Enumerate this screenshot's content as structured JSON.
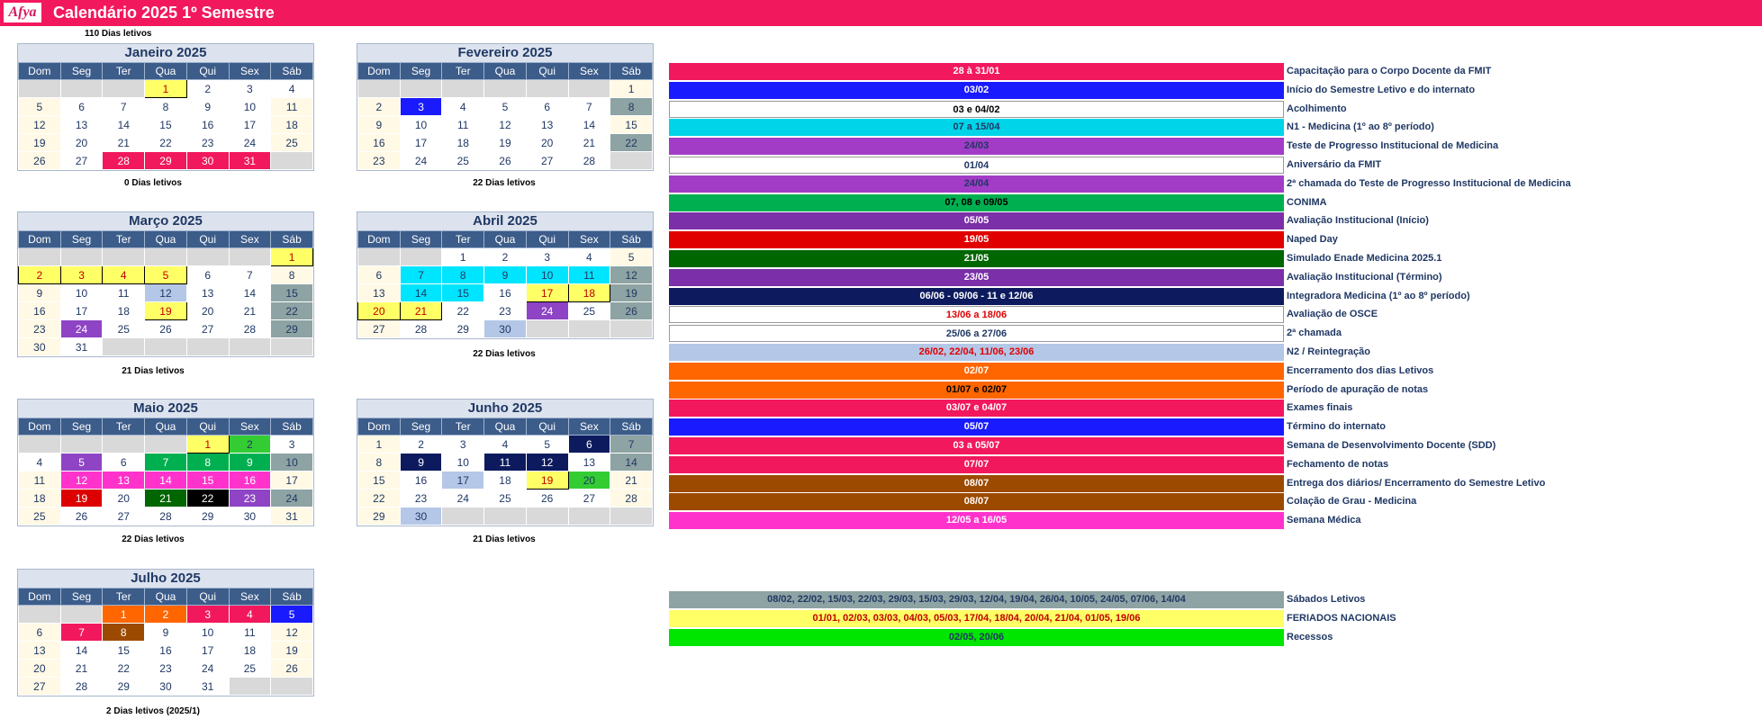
{
  "header": {
    "logo": "Afya",
    "title": "Calendário 2025  1º Semestre",
    "dias_letivos_total": "110  Dias letivos"
  },
  "weekdays": [
    "Dom",
    "Seg",
    "Ter",
    "Qua",
    "Qui",
    "Sex",
    "Sáb"
  ],
  "months": [
    {
      "name": "Janeiro 2025",
      "footer": "0  Dias letivos",
      "cells": [
        [
          "",
          ""
        ],
        [
          "",
          ""
        ],
        [
          "",
          ""
        ],
        [
          "1",
          "#ffff66"
        ],
        [
          "2",
          ""
        ],
        [
          "3",
          ""
        ],
        [
          "4",
          ""
        ],
        [
          "5",
          "w"
        ],
        [
          "6",
          ""
        ],
        [
          "7",
          ""
        ],
        [
          "8",
          ""
        ],
        [
          "9",
          ""
        ],
        [
          "10",
          ""
        ],
        [
          "11",
          "w"
        ],
        [
          "12",
          "w"
        ],
        [
          "13",
          ""
        ],
        [
          "14",
          ""
        ],
        [
          "15",
          ""
        ],
        [
          "16",
          ""
        ],
        [
          "17",
          ""
        ],
        [
          "18",
          "w"
        ],
        [
          "19",
          "w"
        ],
        [
          "20",
          ""
        ],
        [
          "21",
          ""
        ],
        [
          "22",
          ""
        ],
        [
          "23",
          ""
        ],
        [
          "24",
          ""
        ],
        [
          "25",
          "w"
        ],
        [
          "26",
          "w"
        ],
        [
          "27",
          ""
        ],
        [
          "28",
          "#f2185e"
        ],
        [
          "29",
          "#f2185e"
        ],
        [
          "30",
          "#f2185e"
        ],
        [
          "31",
          "#f2185e"
        ],
        [
          "",
          ""
        ]
      ]
    },
    {
      "name": "Fevereiro 2025",
      "footer": "22  Dias letivos",
      "cells": [
        [
          "",
          ""
        ],
        [
          "",
          ""
        ],
        [
          "",
          ""
        ],
        [
          "",
          ""
        ],
        [
          "",
          ""
        ],
        [
          "",
          ""
        ],
        [
          "1",
          "w"
        ],
        [
          "2",
          "w"
        ],
        [
          "3",
          "#1a1aff"
        ],
        [
          "4",
          ""
        ],
        [
          "5",
          ""
        ],
        [
          "6",
          ""
        ],
        [
          "7",
          ""
        ],
        [
          "8",
          "#8ea3a3"
        ],
        [
          "9",
          "w"
        ],
        [
          "10",
          ""
        ],
        [
          "11",
          ""
        ],
        [
          "12",
          ""
        ],
        [
          "13",
          ""
        ],
        [
          "14",
          ""
        ],
        [
          "15",
          "w"
        ],
        [
          "16",
          "w"
        ],
        [
          "17",
          ""
        ],
        [
          "18",
          ""
        ],
        [
          "19",
          ""
        ],
        [
          "20",
          ""
        ],
        [
          "21",
          ""
        ],
        [
          "22",
          "#8ea3a3"
        ],
        [
          "23",
          "w"
        ],
        [
          "24",
          ""
        ],
        [
          "25",
          ""
        ],
        [
          "26",
          ""
        ],
        [
          "27",
          ""
        ],
        [
          "28",
          ""
        ],
        [
          "",
          ""
        ]
      ]
    },
    {
      "name": "Março 2025",
      "footer": "21  Dias letivos",
      "cells": [
        [
          "",
          ""
        ],
        [
          "",
          ""
        ],
        [
          "",
          ""
        ],
        [
          "",
          ""
        ],
        [
          "",
          ""
        ],
        [
          "",
          ""
        ],
        [
          "1",
          "#ffff66"
        ],
        [
          "2",
          "#ffff66"
        ],
        [
          "3",
          "#ffff66"
        ],
        [
          "4",
          "#ffff66"
        ],
        [
          "5",
          "#ffff66"
        ],
        [
          "6",
          ""
        ],
        [
          "7",
          ""
        ],
        [
          "8",
          "w"
        ],
        [
          "9",
          "w"
        ],
        [
          "10",
          ""
        ],
        [
          "11",
          ""
        ],
        [
          "12",
          "#b4c7e7"
        ],
        [
          "13",
          ""
        ],
        [
          "14",
          ""
        ],
        [
          "15",
          "#8ea3a3"
        ],
        [
          "16",
          "w"
        ],
        [
          "17",
          ""
        ],
        [
          "18",
          ""
        ],
        [
          "19",
          "#ffff66"
        ],
        [
          "20",
          ""
        ],
        [
          "21",
          ""
        ],
        [
          "22",
          "#8ea3a3"
        ],
        [
          "23",
          "w"
        ],
        [
          "24",
          "#8e44c4"
        ],
        [
          "25",
          ""
        ],
        [
          "26",
          ""
        ],
        [
          "27",
          ""
        ],
        [
          "28",
          ""
        ],
        [
          "29",
          "#8ea3a3"
        ],
        [
          "30",
          "w"
        ],
        [
          "31",
          ""
        ],
        [
          "",
          ""
        ],
        [
          "",
          ""
        ],
        [
          "",
          ""
        ],
        [
          "",
          ""
        ],
        [
          "",
          ""
        ]
      ]
    },
    {
      "name": "Abril 2025",
      "footer": "22  Dias letivos",
      "cells": [
        [
          "",
          ""
        ],
        [
          "",
          ""
        ],
        [
          "1",
          ""
        ],
        [
          "2",
          ""
        ],
        [
          "3",
          ""
        ],
        [
          "4",
          ""
        ],
        [
          "5",
          "w"
        ],
        [
          "6",
          "w"
        ],
        [
          "7",
          "#00e5ff"
        ],
        [
          "8",
          "#00e5ff"
        ],
        [
          "9",
          "#00e5ff"
        ],
        [
          "10",
          "#00e5ff"
        ],
        [
          "11",
          "#00e5ff"
        ],
        [
          "12",
          "#8ea3a3"
        ],
        [
          "13",
          "w"
        ],
        [
          "14",
          "#00e5ff"
        ],
        [
          "15",
          "#00e5ff"
        ],
        [
          "16",
          ""
        ],
        [
          "17",
          "#ffff66"
        ],
        [
          "18",
          "#ffff66"
        ],
        [
          "19",
          "#8ea3a3"
        ],
        [
          "20",
          "#ffff66"
        ],
        [
          "21",
          "#ffff66"
        ],
        [
          "22",
          ""
        ],
        [
          "23",
          ""
        ],
        [
          "24",
          "#8e44c4"
        ],
        [
          "25",
          ""
        ],
        [
          "26",
          "#8ea3a3"
        ],
        [
          "27",
          "w"
        ],
        [
          "28",
          ""
        ],
        [
          "29",
          ""
        ],
        [
          "30",
          "#b4c7e7"
        ],
        [
          "",
          ""
        ],
        [
          "",
          ""
        ],
        [
          "",
          ""
        ]
      ]
    },
    {
      "name": "Maio 2025",
      "footer": "22  Dias letivos",
      "cells": [
        [
          "",
          ""
        ],
        [
          "",
          ""
        ],
        [
          "",
          ""
        ],
        [
          "",
          ""
        ],
        [
          "1",
          "#ffff66"
        ],
        [
          "2",
          "#33cc33"
        ],
        [
          "3",
          ""
        ],
        [
          "4",
          ""
        ],
        [
          "5",
          "#8e44c4"
        ],
        [
          "6",
          ""
        ],
        [
          "7",
          "#00b050"
        ],
        [
          "8",
          "#00b050"
        ],
        [
          "9",
          "#00b050"
        ],
        [
          "10",
          "#8ea3a3"
        ],
        [
          "11",
          "w"
        ],
        [
          "12",
          "#ff33cc"
        ],
        [
          "13",
          "#ff33cc"
        ],
        [
          "14",
          "#ff33cc"
        ],
        [
          "15",
          "#ff33cc"
        ],
        [
          "16",
          "#ff33cc"
        ],
        [
          "17",
          "w"
        ],
        [
          "18",
          "w"
        ],
        [
          "19",
          "#dd0000"
        ],
        [
          "20",
          ""
        ],
        [
          "21",
          "#006600"
        ],
        [
          "22",
          "#000000"
        ],
        [
          "23",
          "#8e44c4"
        ],
        [
          "24",
          "#8ea3a3"
        ],
        [
          "25",
          "w"
        ],
        [
          "26",
          ""
        ],
        [
          "27",
          ""
        ],
        [
          "28",
          ""
        ],
        [
          "29",
          ""
        ],
        [
          "30",
          ""
        ],
        [
          "31",
          "w"
        ]
      ]
    },
    {
      "name": "Junho 2025",
      "footer": "21  Dias letivos",
      "cells": [
        [
          "1",
          "w"
        ],
        [
          "2",
          ""
        ],
        [
          "3",
          ""
        ],
        [
          "4",
          ""
        ],
        [
          "5",
          ""
        ],
        [
          "6",
          "#0d1b5e"
        ],
        [
          "7",
          "#8ea3a3"
        ],
        [
          "8",
          "w"
        ],
        [
          "9",
          "#0d1b5e"
        ],
        [
          "10",
          ""
        ],
        [
          "11",
          "#0d1b5e"
        ],
        [
          "12",
          "#0d1b5e"
        ],
        [
          "13",
          ""
        ],
        [
          "14",
          "#8ea3a3"
        ],
        [
          "15",
          "w"
        ],
        [
          "16",
          ""
        ],
        [
          "17",
          "#b4c7e7"
        ],
        [
          "18",
          ""
        ],
        [
          "19",
          "#ffff66"
        ],
        [
          "20",
          "#33cc33"
        ],
        [
          "21",
          "w"
        ],
        [
          "22",
          "w"
        ],
        [
          "23",
          ""
        ],
        [
          "24",
          ""
        ],
        [
          "25",
          ""
        ],
        [
          "26",
          ""
        ],
        [
          "27",
          ""
        ],
        [
          "28",
          "w"
        ],
        [
          "29",
          "w"
        ],
        [
          "30",
          "#b4c7e7"
        ],
        [
          "",
          ""
        ],
        [
          "",
          ""
        ],
        [
          "",
          ""
        ],
        [
          "",
          ""
        ],
        [
          "",
          ""
        ]
      ]
    },
    {
      "name": "Julho 2025",
      "footer": "2  Dias letivos (2025/1)",
      "cells": [
        [
          "",
          ""
        ],
        [
          "",
          ""
        ],
        [
          "1",
          "#ff6600"
        ],
        [
          "2",
          "#ff6600"
        ],
        [
          "3",
          "#f2185e"
        ],
        [
          "4",
          "#f2185e"
        ],
        [
          "5",
          "#1a1aff"
        ],
        [
          "6",
          "w"
        ],
        [
          "7",
          "#f2185e"
        ],
        [
          "8",
          "#9c4a00"
        ],
        [
          "9",
          ""
        ],
        [
          "10",
          ""
        ],
        [
          "11",
          ""
        ],
        [
          "12",
          "w"
        ],
        [
          "13",
          "w"
        ],
        [
          "14",
          ""
        ],
        [
          "15",
          ""
        ],
        [
          "16",
          ""
        ],
        [
          "17",
          ""
        ],
        [
          "18",
          ""
        ],
        [
          "19",
          "w"
        ],
        [
          "20",
          "w"
        ],
        [
          "21",
          ""
        ],
        [
          "22",
          ""
        ],
        [
          "23",
          ""
        ],
        [
          "24",
          ""
        ],
        [
          "25",
          ""
        ],
        [
          "26",
          "w"
        ],
        [
          "27",
          "w"
        ],
        [
          "28",
          ""
        ],
        [
          "29",
          ""
        ],
        [
          "30",
          ""
        ],
        [
          "31",
          ""
        ],
        [
          "",
          ""
        ],
        [
          "",
          ""
        ]
      ]
    }
  ],
  "legend": [
    {
      "range": "28 à 31/01",
      "label": "Capacitação para o Corpo Docente da FMIT",
      "bg": "#f2185e",
      "fg": "#ffffff"
    },
    {
      "range": "03/02",
      "label": "Início do Semestre Letivo e do internato",
      "bg": "#1a1aff",
      "fg": "#ffffff"
    },
    {
      "range": "03 e 04/02",
      "label": "Acolhimento",
      "bg": "#ffffff",
      "fg": "#000000"
    },
    {
      "range": "07 a 15/04",
      "label": "N1 - Medicina (1º ao 8º período)",
      "bg": "#00d4e8",
      "fg": "#203864"
    },
    {
      "range": "24/03",
      "label": "Teste de Progresso Institucional de Medicina",
      "bg": "#a23cc7",
      "fg": "#203864"
    },
    {
      "range": "01/04",
      "label": "Aniversário da FMIT",
      "bg": "#ffffff",
      "fg": "#203864"
    },
    {
      "range": "24/04",
      "label": "2ª chamada do Teste de Progresso Institucional de Medicina",
      "bg": "#a23cc7",
      "fg": "#203864"
    },
    {
      "range": "07, 08 e 09/05",
      "label": "CONIMA",
      "bg": "#00b050",
      "fg": "#000000"
    },
    {
      "range": "05/05",
      "label": "Avaliação Institucional (Início)",
      "bg": "#7b2fa8",
      "fg": "#ffffff"
    },
    {
      "range": "19/05",
      "label": "Naped Day",
      "bg": "#e00000",
      "fg": "#ffffff"
    },
    {
      "range": "21/05",
      "label": "Simulado Enade Medicina 2025.1",
      "bg": "#006600",
      "fg": "#ffffff"
    },
    {
      "range": "23/05",
      "label": "Avaliação Institucional (Término)",
      "bg": "#7b2fa8",
      "fg": "#ffffff"
    },
    {
      "range": "06/06 - 09/06 - 11 e 12/06",
      "label": "Integradora Medicina (1º ao 8º período)",
      "bg": "#0d1b5e",
      "fg": "#ffffff"
    },
    {
      "range": "13/06 a 18/06",
      "label": "Avaliação de OSCE",
      "bg": "#ffffff",
      "fg": "#e00000"
    },
    {
      "range": "25/06 a 27/06",
      "label": "2ª chamada",
      "bg": "#ffffff",
      "fg": "#203864"
    },
    {
      "range": "26/02, 22/04, 11/06, 23/06",
      "label": "N2 / Reintegração",
      "bg": "#b4c7e7",
      "fg": "#e00000"
    },
    {
      "range": "02/07",
      "label": "Encerramento dos dias Letivos",
      "bg": "#ff6600",
      "fg": "#ffffff"
    },
    {
      "range": "01/07 e 02/07",
      "label": "Período de apuração de notas",
      "bg": "#ff6600",
      "fg": "#000000"
    },
    {
      "range": "03/07 e 04/07",
      "label": "Exames finais",
      "bg": "#f2185e",
      "fg": "#ffffff"
    },
    {
      "range": "05/07",
      "label": "Término do internato",
      "bg": "#1a1aff",
      "fg": "#ffffff"
    },
    {
      "range": "03 a 05/07",
      "label": "Semana de Desenvolvimento Docente (SDD)",
      "bg": "#f2185e",
      "fg": "#ffffff"
    },
    {
      "range": "07/07",
      "label": "Fechamento de notas",
      "bg": "#f2185e",
      "fg": "#ffffff"
    },
    {
      "range": "08/07",
      "label": "Entrega dos diários/ Encerramento do Semestre Letivo",
      "bg": "#9c4a00",
      "fg": "#ffffff"
    },
    {
      "range": "08/07",
      "label": "Colação de Grau - Medicina",
      "bg": "#9c4a00",
      "fg": "#ffffff"
    },
    {
      "range": "12/05 a 16/05",
      "label": "Semana Médica",
      "bg": "#ff33cc",
      "fg": "#ffffff"
    }
  ],
  "legend2": [
    {
      "range": "08/02, 22/02, 15/03, 22/03, 29/03, 15/03, 29/03, 12/04, 19/04, 26/04, 10/05, 24/05, 07/06, 14/04",
      "label": "Sábados Letivos",
      "bg": "#8ea3a3",
      "fg": "#203864"
    },
    {
      "range": "01/01, 02/03, 03/03, 04/03, 05/03, 17/04, 18/04, 20/04, 21/04, 01/05, 19/06",
      "label": "FERIADOS NACIONAIS",
      "bg": "#ffff66",
      "fg": "#c00000"
    },
    {
      "range": "02/05, 20/06",
      "label": "Recessos",
      "bg": "#00e600",
      "fg": "#203864"
    }
  ]
}
